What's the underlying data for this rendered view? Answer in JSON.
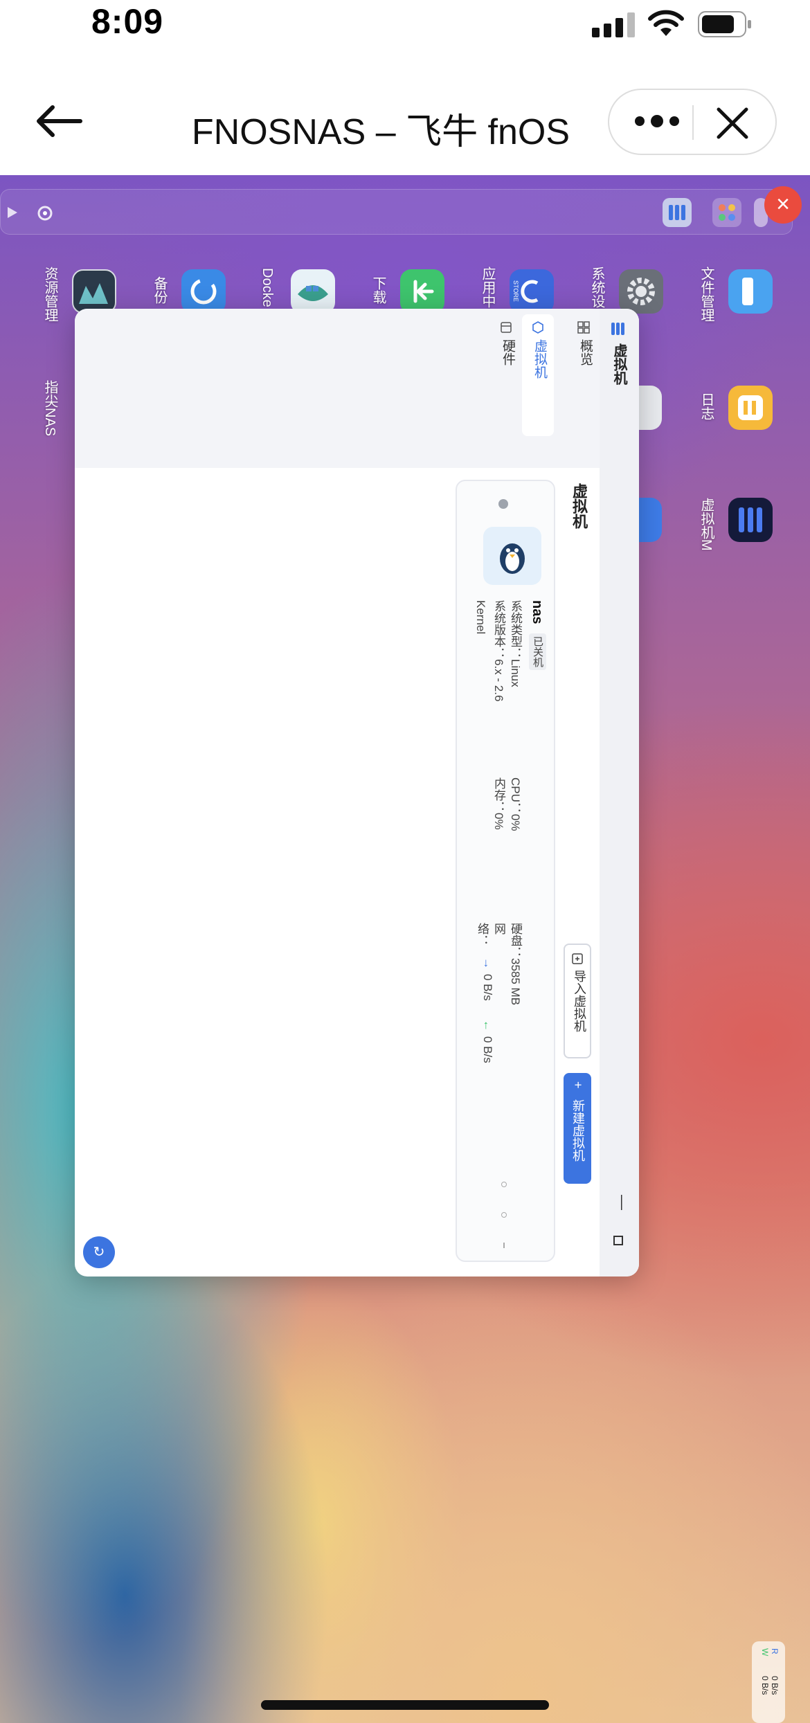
{
  "status_bar": {
    "time": "8:09"
  },
  "nav_bar": {
    "title": "FNOSNAS – 飞牛 fnOS"
  },
  "desktop": {
    "icons": [
      {
        "label": "资源管理",
        "icon": "monitor-icon"
      },
      {
        "label": "备份",
        "icon": "sync-icon"
      },
      {
        "label": "Docke",
        "icon": "docker-icon"
      },
      {
        "label": "下载",
        "icon": "download-icon"
      },
      {
        "label": "应用中心",
        "icon": "store-icon",
        "badge": "STORE"
      },
      {
        "label": "系统设置",
        "icon": "gear-icon"
      },
      {
        "label": "文件管理",
        "icon": "folder-icon"
      },
      {
        "label": "日志",
        "icon": "log-icon"
      },
      {
        "label": "虚拟机M",
        "icon": "vm-icon"
      },
      {
        "label": "指尖NAS",
        "icon": "finger-icon"
      }
    ],
    "net_widget": {
      "up_label": "R",
      "down_label": "W",
      "up": "0 B/s",
      "down": "0 B/s"
    }
  },
  "vm_app": {
    "app_title": "虚拟机",
    "nav": [
      {
        "label": "概览",
        "icon": "grid-icon"
      },
      {
        "label": "虚拟机",
        "icon": "cube-icon"
      },
      {
        "label": "硬件",
        "icon": "hardware-icon"
      }
    ],
    "section_title": "虚拟机",
    "import_label": "导入虚拟机",
    "new_label": "新建虚拟机",
    "vm": {
      "name": "nas",
      "state": "已关机",
      "os_type_line": "系统类型：Linux",
      "os_version_line": "系统版本：6.x - 2.6",
      "kernel": "Kernel",
      "cpu": "CPU：0%",
      "memory": "内存：0%",
      "disk": "硬盘：3585 MB",
      "net_label_1": "网",
      "net_label_2": "络：",
      "net_up": "0 B/s",
      "net_down": "0 B/s"
    }
  }
}
